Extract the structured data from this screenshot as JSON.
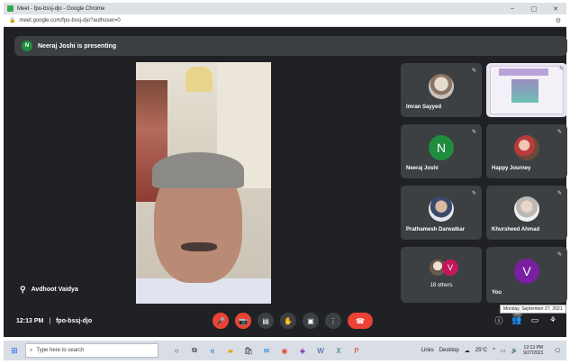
{
  "browser": {
    "title": "Meet - fpo-bssj-djo - Google Chrome",
    "url": "meet.google.com/fpo-bssj-djo?authuser=0",
    "window_controls": [
      "–",
      "▢",
      "✕"
    ]
  },
  "banner": {
    "avatar_letter": "N",
    "text": "Neeraj Joshi is presenting"
  },
  "main_speaker": {
    "name": "Avdhoot Vaidya"
  },
  "tiles": [
    {
      "name": "Imran Sayyed",
      "avatar": "photo"
    },
    {
      "name": "",
      "avatar": "slide"
    },
    {
      "name": "Neeraj Joshi",
      "avatar_letter": "N",
      "color": "#1e8e3e"
    },
    {
      "name": "Happy Journey",
      "avatar": "photo"
    },
    {
      "name": "Prathamesh Darwatkar",
      "avatar": "photo"
    },
    {
      "name": "Khursheed Ahmad",
      "avatar": "photo"
    },
    {
      "name": "18 others",
      "avatar_letter": "V",
      "color": "#c2185b"
    },
    {
      "name": "You",
      "avatar_letter": "V",
      "color": "#7b1fa2"
    }
  ],
  "meeting": {
    "time": "12:13 PM",
    "separator": "|",
    "code": "fpo-bssj-djo",
    "participant_count": "26",
    "tooltip": "Monday, September 27, 2021"
  },
  "taskbar": {
    "search_placeholder": "Type here to search",
    "links": "Links",
    "desktop": "Desktop",
    "temperature": "25°C",
    "time": "12:13 PM",
    "date": "9/27/2021"
  },
  "colors": {
    "meet_bg": "#202124",
    "tile_bg": "#3c4043",
    "end_call": "#ea4335"
  }
}
